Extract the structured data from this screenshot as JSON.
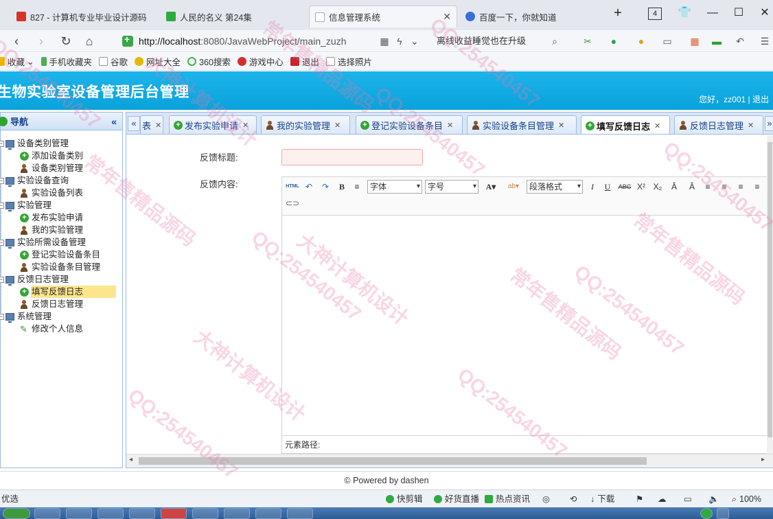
{
  "browser": {
    "tabs": [
      {
        "label": "827 - 计算机专业毕业设计源码",
        "icon_color": "#d8322a"
      },
      {
        "label": "人民的名义 第24集",
        "icon_color": "#2eab3e"
      },
      {
        "label": "信息管理系统",
        "icon_color": "#cfd6e0"
      },
      {
        "label": "百度一下，你就知道",
        "icon_color": "#3a6fd8"
      }
    ],
    "new_tab": "+",
    "tab_count": "4",
    "url_host": "http://localhost",
    "url_rest": ":8080/JavaWebProject/main_zuzh",
    "search_text": "离线收益睡觉也在升级",
    "bookmarks": [
      "收藏",
      "手机收藏夹",
      "谷歌",
      "网址大全",
      "360搜索",
      "游戏中心",
      "退出",
      "选择照片"
    ]
  },
  "header": {
    "title": "生物实验室设备管理后台管理",
    "welcome": "您好，zz001",
    "separator": "|",
    "logout": "退出"
  },
  "nav": {
    "title": "导航",
    "collapse": "«",
    "groups": [
      {
        "label": "设备类别管理",
        "items": [
          {
            "label": "添加设备类别",
            "icon": "add-icon"
          },
          {
            "label": "设备类别管理",
            "icon": "user-icon"
          }
        ]
      },
      {
        "label": "实验设备查询",
        "items": [
          {
            "label": "实验设备列表",
            "icon": "user-icon"
          }
        ]
      },
      {
        "label": "实验管理",
        "items": [
          {
            "label": "发布实验申请",
            "icon": "add-icon"
          },
          {
            "label": "我的实验管理",
            "icon": "user-icon"
          }
        ]
      },
      {
        "label": "实验所需设备管理",
        "items": [
          {
            "label": "登记实验设备条目",
            "icon": "add-icon"
          },
          {
            "label": "实验设备条目管理",
            "icon": "user-icon"
          }
        ]
      },
      {
        "label": "反馈日志管理",
        "items": [
          {
            "label": "填写反馈日志",
            "icon": "add-icon",
            "selected": true
          },
          {
            "label": "反馈日志管理",
            "icon": "user-icon"
          }
        ]
      },
      {
        "label": "系统管理",
        "items": [
          {
            "label": "修改个人信息",
            "icon": "pencil-icon"
          }
        ]
      }
    ]
  },
  "content_tabs": [
    {
      "label": "表",
      "icon": "none"
    },
    {
      "label": "发布实验申请",
      "icon": "add-icon"
    },
    {
      "label": "我的实验管理",
      "icon": "user-icon"
    },
    {
      "label": "登记实验设备条目",
      "icon": "add-icon"
    },
    {
      "label": "实验设备条目管理",
      "icon": "user-icon"
    },
    {
      "label": "填写反馈日志",
      "icon": "add-icon",
      "active": true
    },
    {
      "label": "反馈日志管理",
      "icon": "user-icon"
    }
  ],
  "form": {
    "title_label": "反馈标题:",
    "title_value": "",
    "content_label": "反馈内容:",
    "editor": {
      "html_btn": "HTML",
      "font_select": "字体",
      "size_select": "字号",
      "paragraph_select": "段落格式",
      "path_label": "元素路径:"
    }
  },
  "footer": {
    "text": "© Powered by dashen"
  },
  "statusbar": {
    "left": "优选",
    "items": [
      "快剪辑",
      "好货直播",
      "热点资讯",
      "下载"
    ],
    "zoom": "100%"
  },
  "watermarks": [
    "QQ:254540457",
    "大神计算机设计",
    "常年售精品源码"
  ]
}
